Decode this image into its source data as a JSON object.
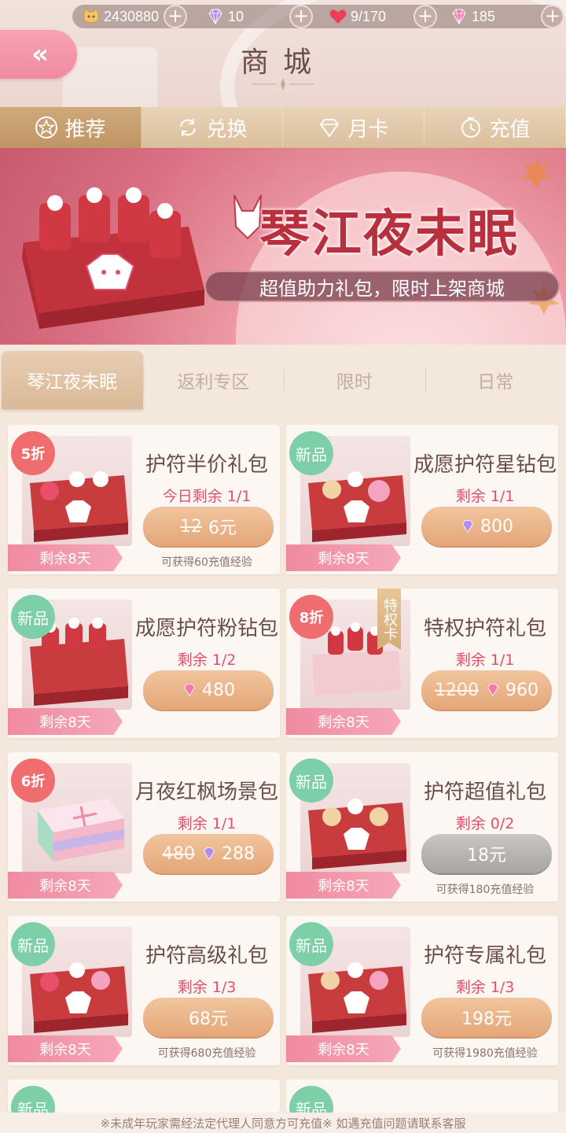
{
  "currency": {
    "gold": "2430880",
    "diamond": "10",
    "heart": "9/170",
    "pink_diamond": "185",
    "plus": "+"
  },
  "header": {
    "back_label": "«",
    "title": "商城"
  },
  "main_tabs": [
    {
      "label": "推荐",
      "icon": "star-icon"
    },
    {
      "label": "兑换",
      "icon": "exchange-icon"
    },
    {
      "label": "月卡",
      "icon": "diamond-card-icon"
    },
    {
      "label": "充值",
      "icon": "clock-icon"
    }
  ],
  "banner": {
    "title": "琴江夜未眠",
    "subtitle": "超值助力礼包，限时上架商城"
  },
  "sub_tabs": [
    {
      "label": "琴江夜未眠",
      "active": true
    },
    {
      "label": "返利专区"
    },
    {
      "label": "限时"
    },
    {
      "label": "日常"
    }
  ],
  "products": [
    {
      "name": "护符半价礼包",
      "badge": "5折",
      "badge_type": "sale",
      "stock": "今日剩余 1/1",
      "old_price": "12",
      "price": "6元",
      "price_type": "cash",
      "exp": "可获得60充值经验",
      "remain": "剩余8天"
    },
    {
      "name": "成愿护符星钻包",
      "badge": "新品",
      "badge_type": "new",
      "stock": "剩余 1/1",
      "price": "800",
      "price_type": "purple-gem",
      "remain": "剩余8天"
    },
    {
      "name": "成愿护符粉钻包",
      "badge": "新品",
      "badge_type": "new",
      "stock": "剩余 1/2",
      "price": "480",
      "price_type": "pink-gem",
      "remain": "剩余8天"
    },
    {
      "name": "特权护符礼包",
      "badge": "8折",
      "badge_type": "sale",
      "tag": "特权卡",
      "stock": "剩余 1/1",
      "old_price": "1200",
      "price": "960",
      "price_type": "pink-gem",
      "remain": "剩余8天"
    },
    {
      "name": "月夜红枫场景包",
      "badge": "6折",
      "badge_type": "sale",
      "stock": "剩余 1/1",
      "old_price": "480",
      "price": "288",
      "price_type": "purple-gem",
      "remain": "剩余8天"
    },
    {
      "name": "护符超值礼包",
      "badge": "新品",
      "badge_type": "new",
      "stock": "剩余 0/2",
      "price": "18元",
      "price_type": "cash-gray",
      "exp": "可获得180充值经验",
      "remain": "剩余8天"
    },
    {
      "name": "护符高级礼包",
      "badge": "新品",
      "badge_type": "new",
      "stock": "剩余 1/3",
      "price": "68元",
      "price_type": "cash",
      "exp": "可获得680充值经验",
      "remain": "剩余8天"
    },
    {
      "name": "护符专属礼包",
      "badge": "新品",
      "badge_type": "new",
      "stock": "剩余 1/3",
      "price": "198元",
      "price_type": "cash",
      "exp": "可获得1980充值经验",
      "remain": "剩余8天"
    },
    {
      "badge": "新品",
      "badge_type": "new"
    },
    {
      "badge": "新品",
      "badge_type": "new"
    }
  ],
  "footer": {
    "notice": "※未成年玩家需经法定代理人同意方可充值※ 如遇充值问题请联系客服"
  },
  "colors": {
    "accent_pink": "#f08aa0",
    "price_orange": "#e4a679",
    "stock_red": "#e0506a",
    "new_badge": "#7ccfa6",
    "sale_badge": "#f06d6f"
  }
}
